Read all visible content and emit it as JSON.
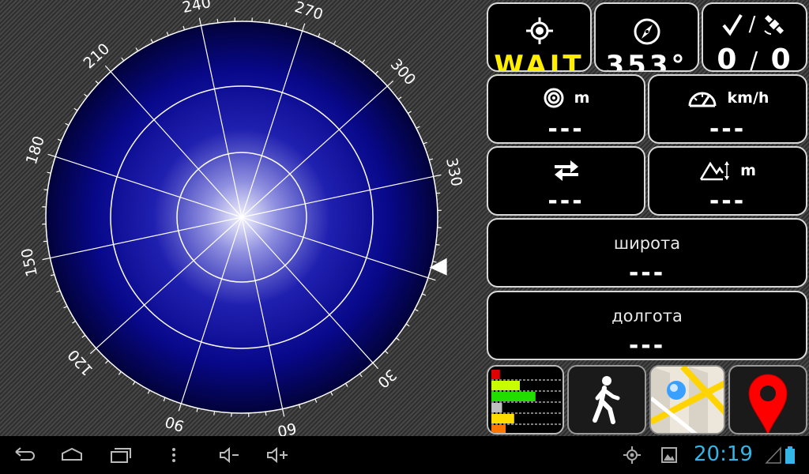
{
  "compass": {
    "bearing_labels": [
      "330",
      "300",
      "270",
      "240",
      "210",
      "180",
      "150",
      "120",
      "90",
      "60",
      "30"
    ],
    "heading_marker": "triangle"
  },
  "panels": {
    "fix": {
      "icon": "gps-target-icon",
      "value": "WAIT",
      "value_color": "#ffee00"
    },
    "bearing": {
      "icon": "compass-icon",
      "value": "353°"
    },
    "satellites": {
      "icon_check": "check-icon",
      "icon_sat": "satellite-icon",
      "separator": "/",
      "used": "0",
      "total": "0"
    },
    "accuracy": {
      "icon": "accuracy-icon",
      "unit": "m",
      "value": "---"
    },
    "speed": {
      "icon": "speedometer-icon",
      "unit": "km/h",
      "value": "---"
    },
    "direction": {
      "icon": "direction-arrows-icon",
      "value": "---"
    },
    "altitude": {
      "icon": "mountain-icon",
      "unit": "m",
      "value": "---"
    },
    "latitude": {
      "label": "широта",
      "value": "---"
    },
    "longitude": {
      "label": "долгота",
      "value": "---"
    }
  },
  "bottom_buttons": [
    "signal-bars-button",
    "walking-mode-button",
    "map-button",
    "location-pin-button"
  ],
  "signal_bars": [
    {
      "value": 0.12,
      "color": "#e00000"
    },
    {
      "value": 0.4,
      "color": "#c8ff00"
    },
    {
      "value": 0.62,
      "color": "#22dd00"
    },
    {
      "value": 0.15,
      "color": "#c0c0c0"
    },
    {
      "value": 0.32,
      "color": "#ffdd00"
    },
    {
      "value": 0.2,
      "color": "#ff7700"
    }
  ],
  "status_bar": {
    "time": "20:19",
    "accent": "#33b5e5",
    "nav_icons": [
      "back-icon",
      "home-icon",
      "recents-icon",
      "menu-icon",
      "volume-down-icon",
      "volume-up-icon"
    ],
    "status_icons": [
      "gps-status-icon",
      "image-notification-icon",
      "signal-icon",
      "battery-icon"
    ]
  }
}
